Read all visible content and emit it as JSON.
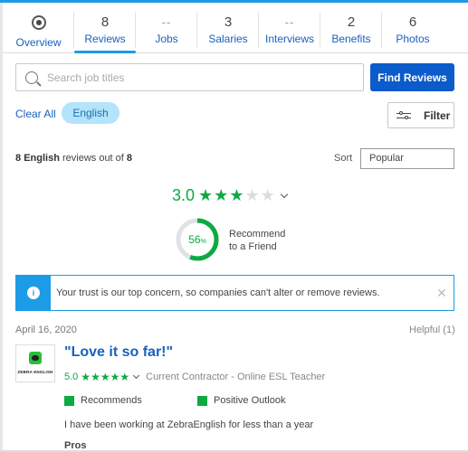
{
  "tabs": [
    {
      "count": "",
      "label": "Overview",
      "icon": "overview-icon"
    },
    {
      "count": "8",
      "label": "Reviews",
      "active": true
    },
    {
      "count": "--",
      "label": "Jobs"
    },
    {
      "count": "3",
      "label": "Salaries"
    },
    {
      "count": "--",
      "label": "Interviews"
    },
    {
      "count": "2",
      "label": "Benefits"
    },
    {
      "count": "6",
      "label": "Photos"
    }
  ],
  "search": {
    "placeholder": "Search job titles",
    "value": "",
    "button_label": "Find Reviews"
  },
  "filters": {
    "clear_all": "Clear All",
    "chip": "English",
    "filter_button": "Filter"
  },
  "summary": {
    "count": "8",
    "language": "English",
    "middle": "reviews out of",
    "total": "8"
  },
  "sort": {
    "label": "Sort",
    "selected": "Popular"
  },
  "overall": {
    "rating": "3.0",
    "stars_filled": 3,
    "stars_total": 5,
    "recommend_percent": 56,
    "recommend_percent_label": "56",
    "percent_sign": "%",
    "recommend_line1": "Recommend",
    "recommend_line2": "to a Friend"
  },
  "notice": {
    "icon": "i",
    "message": "Your trust is our top concern, so companies can't alter or remove reviews.",
    "close": "✕"
  },
  "review": {
    "date": "April 16, 2020",
    "helpful": "Helpful (1)",
    "logo_text": "ZEBRA ENGLISH",
    "title": "\"Love it so far!\"",
    "rating": "5.0",
    "stars_filled": 5,
    "role": "Current Contractor - Online ESL Teacher",
    "flags": [
      "Recommends",
      "Positive Outlook"
    ],
    "experience": "I have been working at ZebraEnglish for less than a year",
    "pros_label": "Pros"
  },
  "colors": {
    "accent": "#1c9be6",
    "brand_blue": "#0c5bcb",
    "link": "#1861bf",
    "green": "#0caa41"
  }
}
